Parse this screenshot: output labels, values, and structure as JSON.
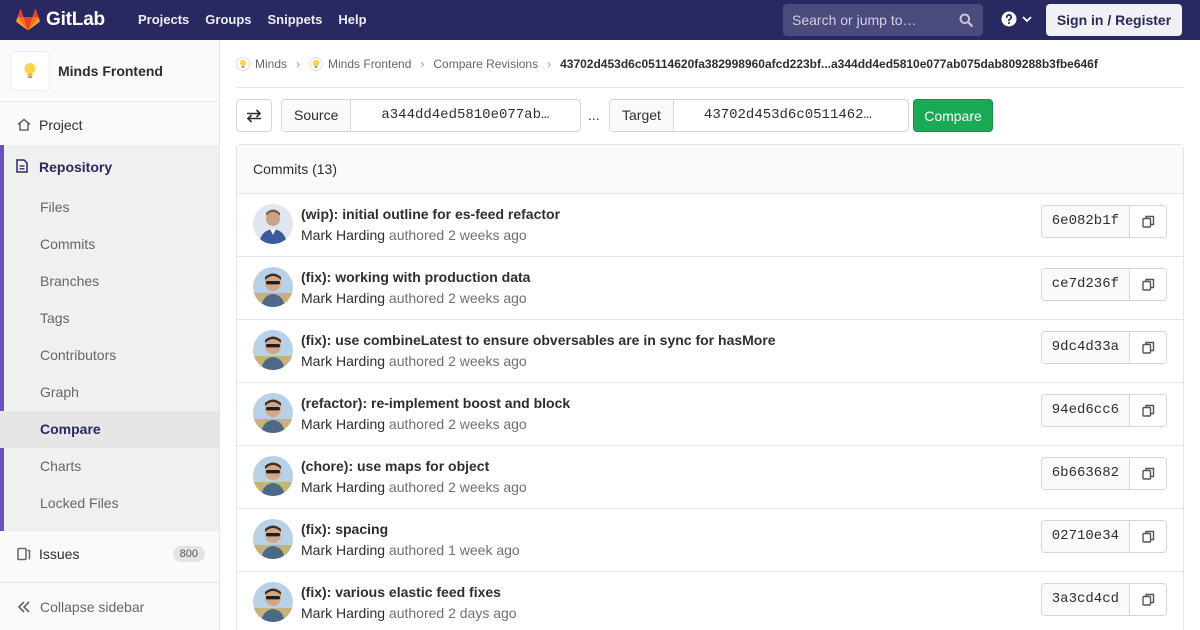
{
  "navbar": {
    "brand": "GitLab",
    "links": [
      "Projects",
      "Groups",
      "Snippets",
      "Help"
    ],
    "search_placeholder": "Search or jump to…",
    "signin": "Sign in / Register"
  },
  "sidebar": {
    "project_name": "Minds Frontend",
    "project": "Project",
    "repository": "Repository",
    "repo_items": [
      "Files",
      "Commits",
      "Branches",
      "Tags",
      "Contributors",
      "Graph",
      "Compare",
      "Charts",
      "Locked Files"
    ],
    "active_item": "Compare",
    "issues": "Issues",
    "issues_count": "800",
    "collapse": "Collapse sidebar"
  },
  "breadcrumb": {
    "items": [
      "Minds",
      "Minds Frontend",
      "Compare Revisions"
    ],
    "current": "43702d453d6c05114620fa382998960afcd223bf...a344dd4ed5810e077ab075dab809288b3fbe646f"
  },
  "compare": {
    "source_label": "Source",
    "source_value": "a344dd4ed5810e077ab…",
    "separator": "...",
    "target_label": "Target",
    "target_value": "43702d453d6c0511462…",
    "button": "Compare"
  },
  "commits": {
    "header": "Commits (13)",
    "items": [
      {
        "title": "(wip): initial outline for es-feed refactor",
        "author": "Mark Harding",
        "verb": "authored",
        "time": "2 weeks ago",
        "sha": "6e082b1f"
      },
      {
        "title": "(fix): working with production data",
        "author": "Mark Harding",
        "verb": "authored",
        "time": "2 weeks ago",
        "sha": "ce7d236f"
      },
      {
        "title": "(fix): use combineLatest to ensure obversables are in sync for hasMore",
        "author": "Mark Harding",
        "verb": "authored",
        "time": "2 weeks ago",
        "sha": "9dc4d33a"
      },
      {
        "title": "(refactor): re-implement boost and block",
        "author": "Mark Harding",
        "verb": "authored",
        "time": "2 weeks ago",
        "sha": "94ed6cc6"
      },
      {
        "title": "(chore): use maps for object",
        "author": "Mark Harding",
        "verb": "authored",
        "time": "2 weeks ago",
        "sha": "6b663682"
      },
      {
        "title": "(fix): spacing",
        "author": "Mark Harding",
        "verb": "authored",
        "time": "1 week ago",
        "sha": "02710e34"
      },
      {
        "title": "(fix): various elastic feed fixes",
        "author": "Mark Harding",
        "verb": "authored",
        "time": "2 days ago",
        "sha": "3a3cd4cd"
      }
    ]
  }
}
